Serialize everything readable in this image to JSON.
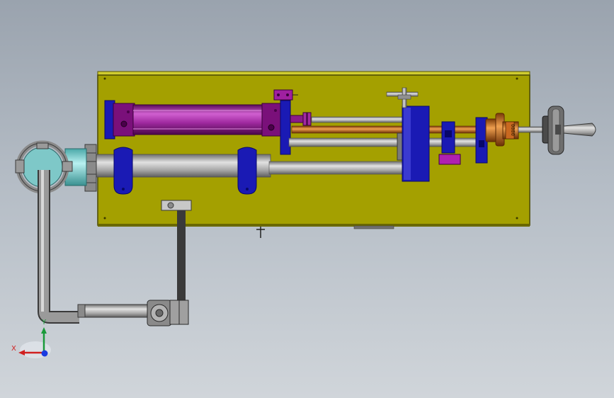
{
  "viewport": {
    "background_top": "#9aa3ae",
    "background_bottom": "#d0d5da"
  },
  "model": {
    "base_plate_color": "#a4a000",
    "cylinder_color": "#9a1e9a",
    "bracket_color": "#1a1ab4",
    "rod_color": "#b0b0b0",
    "tube_color": "#8a8a8a",
    "flange_color": "#7fd0d0",
    "brass_color": "#c87020",
    "counter_text": "0000"
  },
  "triad": {
    "x_label": "X",
    "y_label": "Y",
    "x_color": "#d02020",
    "y_color": "#1a9a3a",
    "z_color": "#1a3ae0"
  }
}
